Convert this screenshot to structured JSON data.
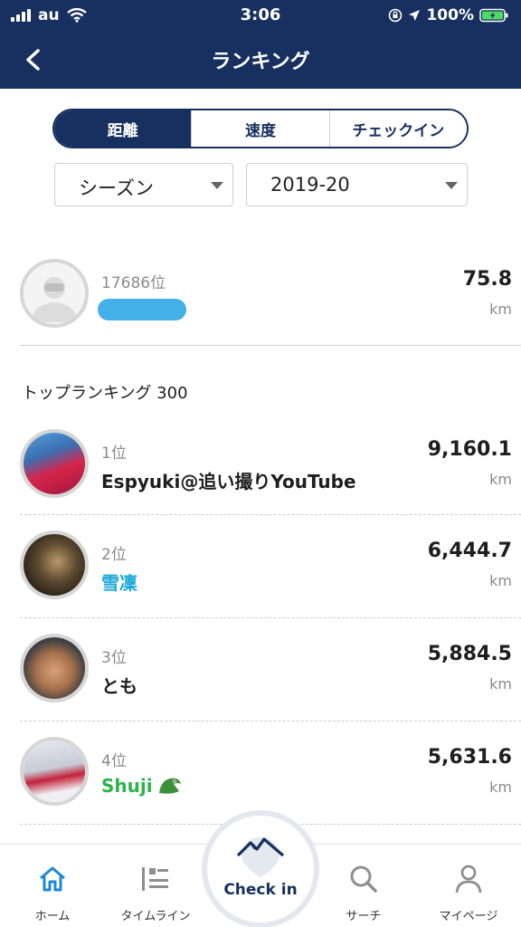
{
  "status_bar": {
    "carrier": "au",
    "time": "3:06",
    "battery": "100%"
  },
  "nav": {
    "title": "ランキング",
    "back_icon": "chevron-left-icon"
  },
  "segments": [
    {
      "label": "距離",
      "active": true
    },
    {
      "label": "速度",
      "active": false
    },
    {
      "label": "チェックイン",
      "active": false
    }
  ],
  "filters": {
    "period": "シーズン",
    "season": "2019-20"
  },
  "my_rank": {
    "rank": "17686位",
    "distance": "75.8",
    "unit": "km"
  },
  "section_title": "トップランキング 300",
  "rankings": [
    {
      "rank": "1位",
      "name": "Espyuki@追い撮りYouTube",
      "distance": "9,160.1",
      "unit": "km",
      "name_color": "#1e1e1e"
    },
    {
      "rank": "2位",
      "name": "雪凜",
      "distance": "6,444.7",
      "unit": "km",
      "name_color": "#1ea9d8"
    },
    {
      "rank": "3位",
      "name": "とも",
      "distance": "5,884.5",
      "unit": "km",
      "name_color": "#1e1e1e"
    },
    {
      "rank": "4位",
      "name": "Shuji",
      "distance": "5,631.6",
      "unit": "km",
      "name_color": "#2db34a"
    }
  ],
  "tabbar": {
    "home": "ホーム",
    "timeline": "タイムライン",
    "checkin": "Check in",
    "search": "サーチ",
    "mypage": "マイページ"
  },
  "colors": {
    "navy": "#17305f",
    "accent_blue": "#1e88d8"
  }
}
